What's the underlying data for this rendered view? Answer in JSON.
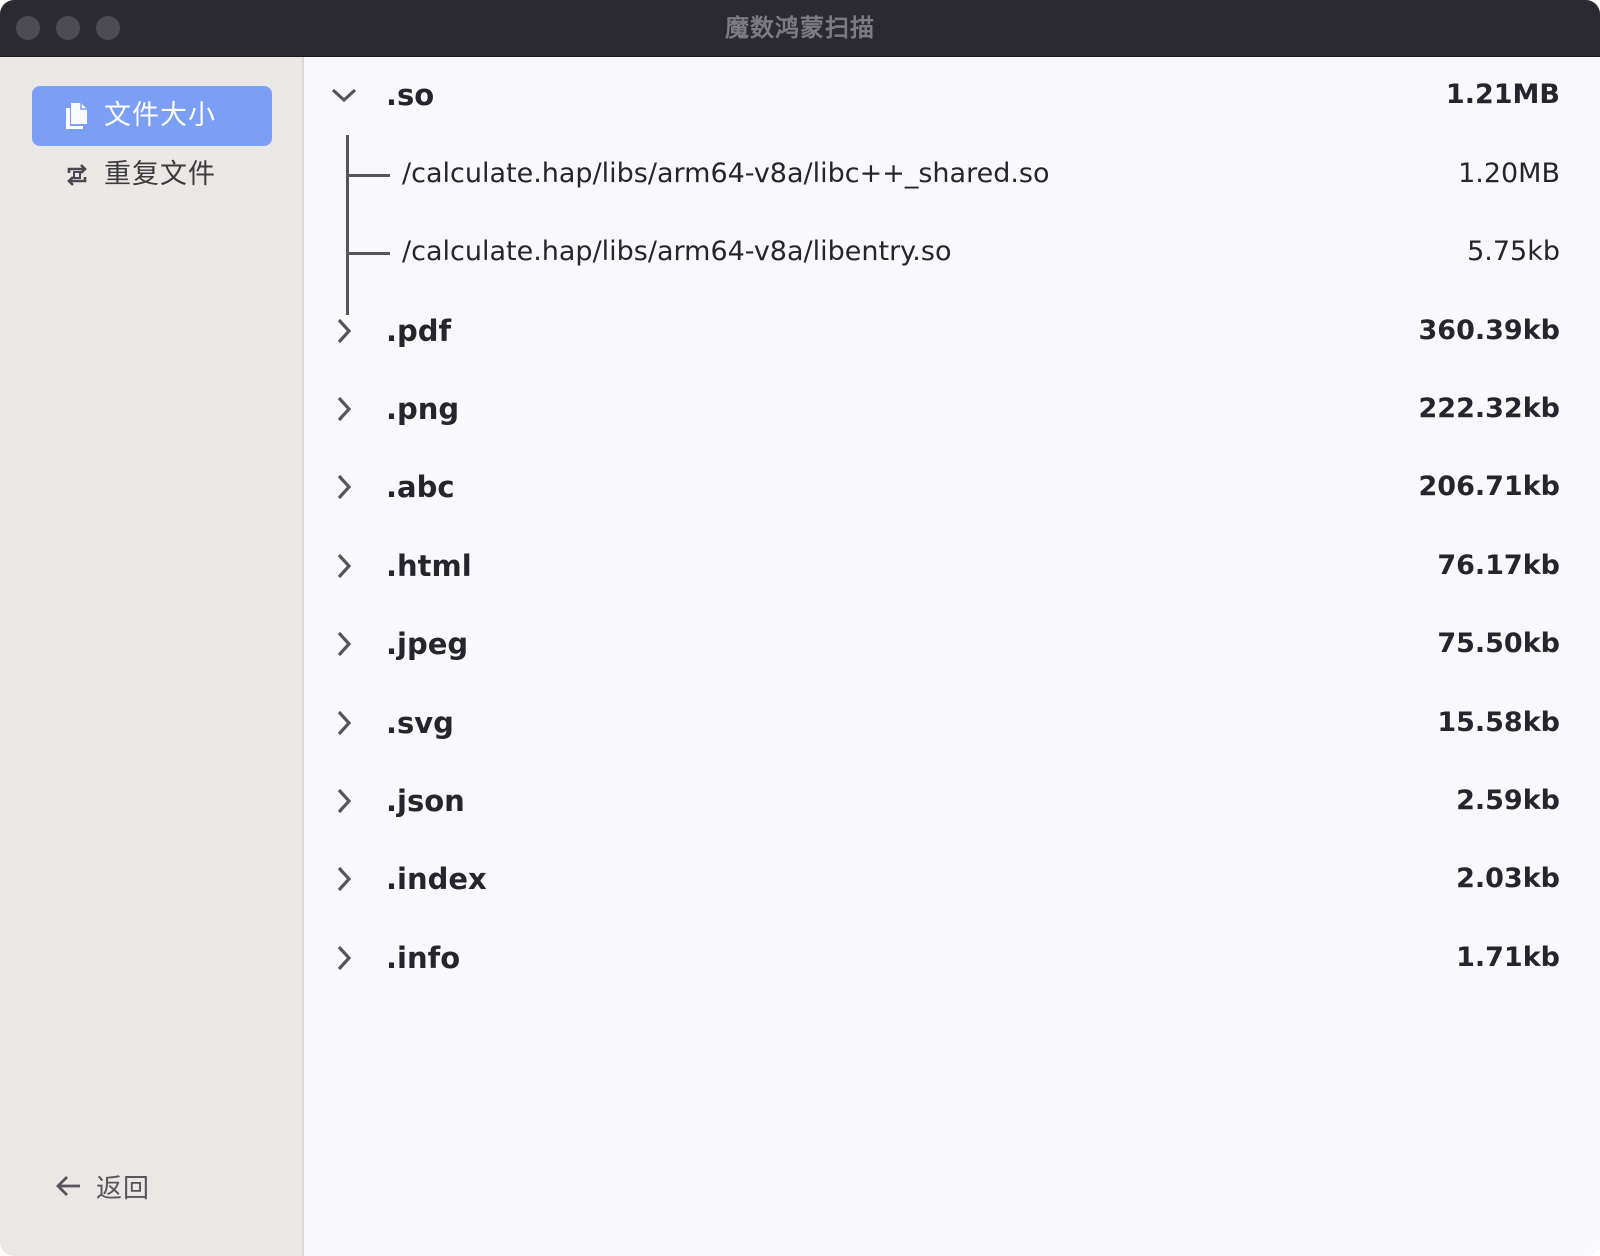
{
  "window": {
    "title": "魔数鸿蒙扫描"
  },
  "sidebar": {
    "items": [
      {
        "label": "文件大小",
        "icon": "copy-files-icon",
        "active": true
      },
      {
        "label": "重复文件",
        "icon": "repeat-icon",
        "active": false
      }
    ],
    "back_label": "返回",
    "back_icon": "arrow-left-icon"
  },
  "colors": {
    "accent": "#7b9ff5",
    "sidebar_bg": "#ebe7e4",
    "titlebar_bg": "#2b2a31",
    "main_bg": "#f8f8fd",
    "text": "#26252b"
  },
  "tree": {
    "groups": [
      {
        "ext": ".so",
        "size": "1.21MB",
        "expanded": true,
        "children": [
          {
            "path": "/calculate.hap/libs/arm64-v8a/libc++_shared.so",
            "size": "1.20MB"
          },
          {
            "path": "/calculate.hap/libs/arm64-v8a/libentry.so",
            "size": "5.75kb"
          }
        ]
      },
      {
        "ext": ".pdf",
        "size": "360.39kb",
        "expanded": false
      },
      {
        "ext": ".png",
        "size": "222.32kb",
        "expanded": false
      },
      {
        "ext": ".abc",
        "size": "206.71kb",
        "expanded": false
      },
      {
        "ext": ".html",
        "size": "76.17kb",
        "expanded": false
      },
      {
        "ext": ".jpeg",
        "size": "75.50kb",
        "expanded": false
      },
      {
        "ext": ".svg",
        "size": "15.58kb",
        "expanded": false
      },
      {
        "ext": ".json",
        "size": "2.59kb",
        "expanded": false
      },
      {
        "ext": ".index",
        "size": "2.03kb",
        "expanded": false
      },
      {
        "ext": ".info",
        "size": "1.71kb",
        "expanded": false
      }
    ]
  }
}
